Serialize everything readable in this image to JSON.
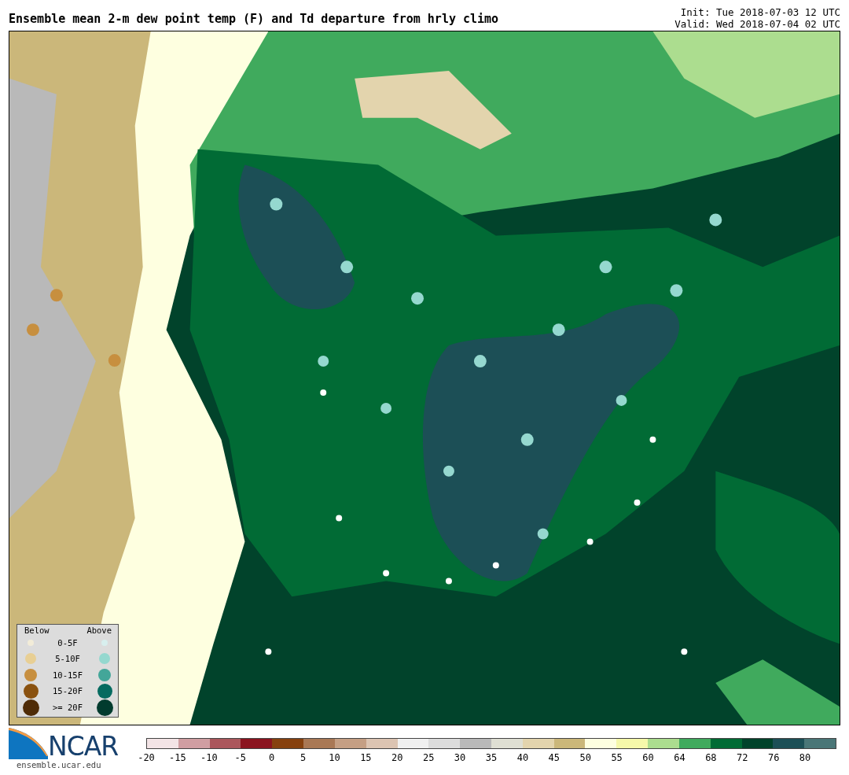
{
  "title": "Ensemble mean 2-m dew point temp (F) and Td departure from hrly climo",
  "init": "Init: Tue 2018-07-03 12 UTC",
  "valid": "Valid: Wed 2018-07-04 02 UTC",
  "legend": {
    "below_heading": "Below",
    "above_heading": "Above",
    "rows": [
      {
        "label": "0-5F",
        "below": {
          "color": "#f2ecd8"
        },
        "above": {
          "color": "#d8efee"
        }
      },
      {
        "label": "5-10F",
        "below": {
          "color": "#e8cf94"
        },
        "above": {
          "color": "#95d8cf"
        }
      },
      {
        "label": "10-15F",
        "below": {
          "color": "#c78f3f"
        },
        "above": {
          "color": "#43a699"
        }
      },
      {
        "label": "15-20F",
        "below": {
          "color": "#8a5210"
        },
        "above": {
          "color": "#066b60"
        }
      },
      {
        "label": ">= 20F",
        "below": {
          "color": "#4f2c07"
        },
        "above": {
          "color": "#013b2e"
        }
      }
    ]
  },
  "logo": {
    "text": "NCAR",
    "url": "ensemble.ucar.edu"
  },
  "colorbar": {
    "bins": [
      {
        "color": "#f3e4e6"
      },
      {
        "color": "#d09ea2"
      },
      {
        "color": "#ab575c"
      },
      {
        "color": "#8b141f"
      },
      {
        "color": "#86410f"
      },
      {
        "color": "#a97855"
      },
      {
        "color": "#c59f84"
      },
      {
        "color": "#dcc4b2"
      },
      {
        "color": "#f0f0f0"
      },
      {
        "color": "#dcdcdc"
      },
      {
        "color": "#b9b9b9"
      },
      {
        "color": "#dfdfd3"
      },
      {
        "color": "#e3d4ad"
      },
      {
        "color": "#cbb77a"
      },
      {
        "color": "#feffe0"
      },
      {
        "color": "#f5f8aa"
      },
      {
        "color": "#acdd8f"
      },
      {
        "color": "#40aa5d"
      },
      {
        "color": "#016b35"
      },
      {
        "color": "#01432b"
      },
      {
        "color": "#1c4f56"
      },
      {
        "color": "#4a7677"
      }
    ],
    "ticks": [
      "-20",
      "-15",
      "-10",
      "-5",
      "0",
      "5",
      "10",
      "15",
      "20",
      "25",
      "30",
      "35",
      "40",
      "45",
      "50",
      "55",
      "60",
      "64",
      "68",
      "72",
      "76",
      "80"
    ]
  }
}
